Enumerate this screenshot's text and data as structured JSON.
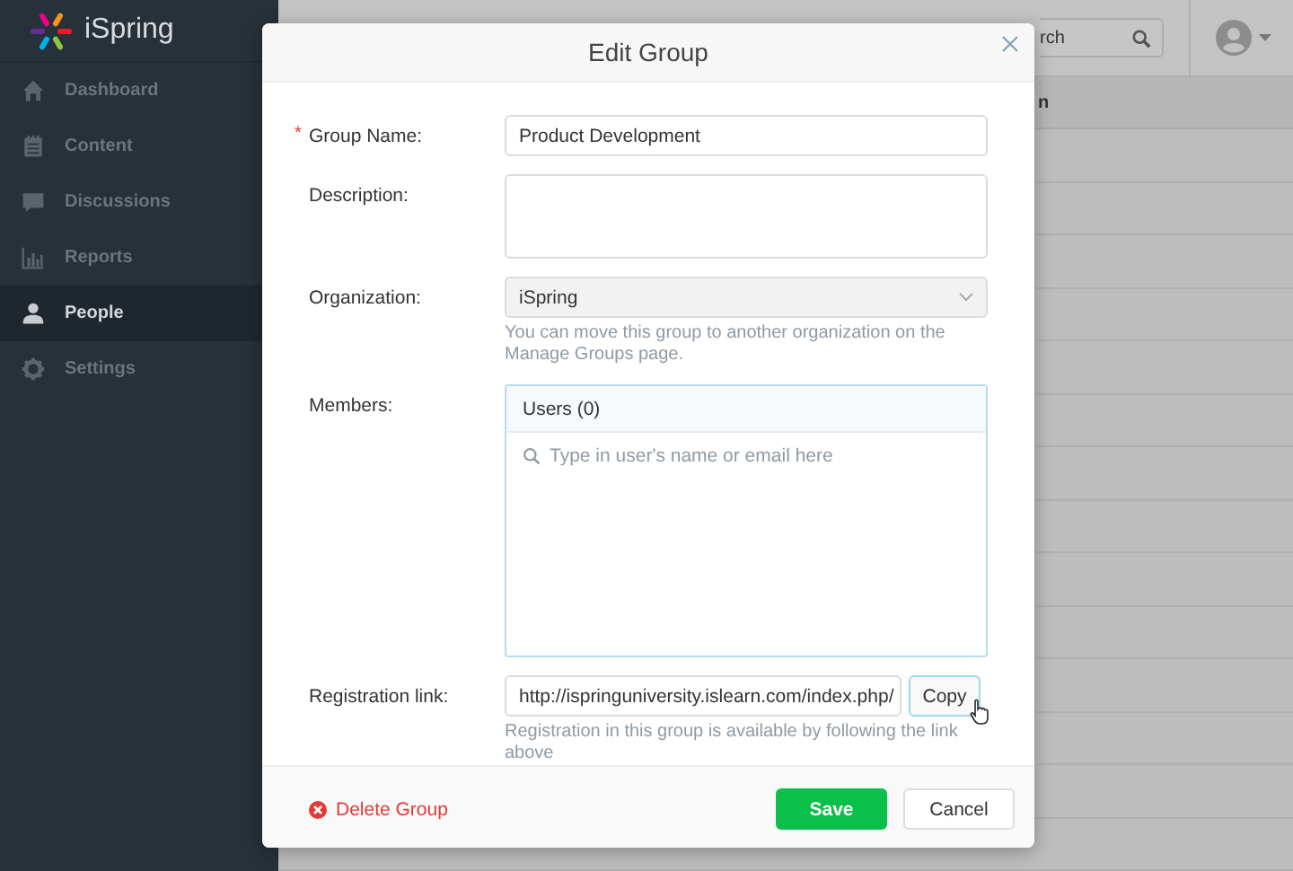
{
  "sidebar": {
    "logo": "iSpring",
    "items": [
      {
        "label": "Dashboard",
        "selected": false
      },
      {
        "label": "Content",
        "selected": false
      },
      {
        "label": "Discussions",
        "selected": false
      },
      {
        "label": "Reports",
        "selected": false
      },
      {
        "label": "People",
        "selected": true
      },
      {
        "label": "Settings",
        "selected": false
      }
    ]
  },
  "header": {
    "search": {
      "value": "rch"
    }
  },
  "table": {
    "columns": [
      {
        "label": "n"
      }
    ]
  },
  "dialog": {
    "title": "Edit Group",
    "group_name": {
      "label": "Group Name:",
      "required_mark": "*",
      "value": "Product Development"
    },
    "description": {
      "label": "Description:"
    },
    "organization": {
      "label": "Organization:",
      "value": "iSpring",
      "hint": "You can move this group to another organization on the Manage Groups page."
    },
    "members": {
      "label": "Members:",
      "tab": "Users (0)",
      "placeholder": "Type in user's name or email here"
    },
    "registration": {
      "label": "Registration link:",
      "value": "http://ispringuniversity.islearn.com/index.php/",
      "copy": "Copy",
      "hint": "Registration in this group is available by following the link above"
    },
    "delete": "Delete Group",
    "save": "Save",
    "cancel": "Cancel"
  }
}
